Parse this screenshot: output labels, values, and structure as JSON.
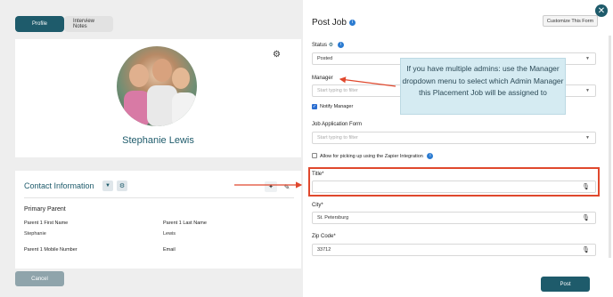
{
  "tabs": [
    {
      "label": "Profile",
      "active": true
    },
    {
      "label": "Interview Notes",
      "active": false
    }
  ],
  "profile": {
    "name": "Stephanie Lewis"
  },
  "contact": {
    "title": "Contact Information",
    "section": "Primary Parent",
    "fields": [
      {
        "label": "Parent 1 First Name",
        "value": "Stephanie"
      },
      {
        "label": "Parent 1 Last Name",
        "value": "Lewis"
      },
      {
        "label": "Parent 1 Mobile Number",
        "value": ""
      },
      {
        "label": "Email",
        "value": ""
      }
    ]
  },
  "buttons": {
    "cancel": "Cancel",
    "post": "Post",
    "customize": "Customize This Form"
  },
  "form": {
    "title": "Post Job",
    "status_label": "Status",
    "status_value": "Posted",
    "manager_label": "Manager",
    "manager_placeholder": "Start typing to filter",
    "notify_manager_label": "Notify Manager",
    "notify_manager_checked": true,
    "application_form_label": "Job Application Form",
    "application_form_placeholder": "Start typing to filter",
    "zapier_label": "Allow for picking up using the Zapier Integration",
    "zapier_checked": false,
    "job_title_label": "Title*",
    "job_title_value": "",
    "city_label": "City*",
    "city_value": "St. Petersburg",
    "zip_label": "Zip Code*",
    "zip_value": "33712"
  },
  "tooltip": {
    "text": "If you have multiple admins: use the Manager dropdown menu to select which Admin Manager this Placement Job will be assigned to"
  },
  "colors": {
    "accent": "#1e5b6b",
    "highlight": "#e0482d",
    "tooltip_bg": "#d5ebf2",
    "info": "#2b7bd1"
  }
}
